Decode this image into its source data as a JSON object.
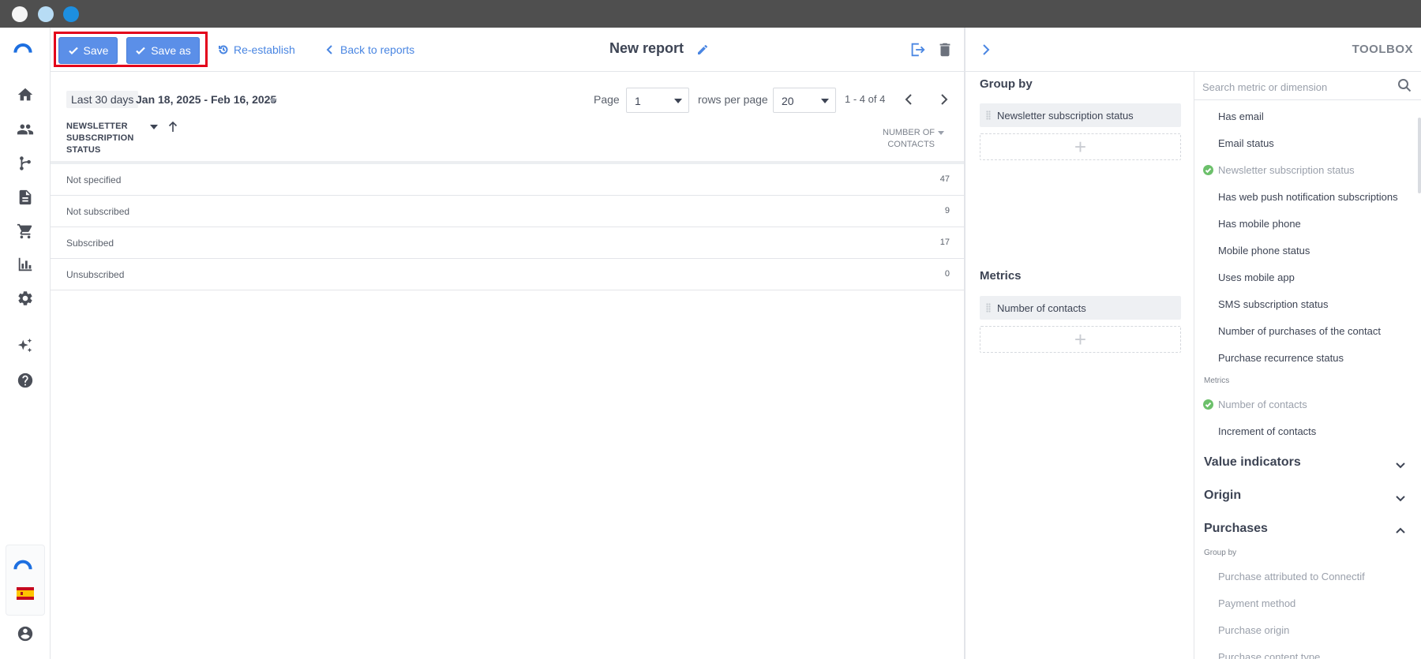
{
  "window": {
    "dot_colors": [
      "#f5f5f5",
      "#b7dcf5",
      "#1d8fe0"
    ]
  },
  "sidebar": {
    "items": [
      {
        "icon": "home-icon"
      },
      {
        "icon": "contacts-icon"
      },
      {
        "icon": "flows-icon"
      },
      {
        "icon": "document-icon"
      },
      {
        "icon": "cart-icon"
      },
      {
        "icon": "bar-chart-icon"
      },
      {
        "icon": "settings-icon"
      },
      {
        "icon": "sparkles-icon"
      },
      {
        "icon": "help-icon"
      }
    ],
    "language_flag": "spain-flag-icon"
  },
  "toolbar": {
    "save_label": "Save",
    "save_as_label": "Save as",
    "reestablish_label": "Re-establish",
    "back_label": "Back to reports",
    "title": "New report",
    "accent_color": "#5b8fe8",
    "highlight_color": "#e3001b"
  },
  "filters": {
    "date_preset": "Last 30 days",
    "date_range": "Jan 18, 2025 - Feb 16, 2025",
    "page_label": "Page",
    "page_value": "1",
    "rows_label": "rows per page",
    "rows_value": "20",
    "range_label": "1 - 4 of 4"
  },
  "table": {
    "col1_header": "Newsletter subscription status",
    "col2_header": "Number of contacts",
    "rows": [
      {
        "status": "Not specified",
        "count": "47"
      },
      {
        "status": "Not subscribed",
        "count": "9"
      },
      {
        "status": "Subscribed",
        "count": "17"
      },
      {
        "status": "Unsubscribed",
        "count": "0"
      }
    ]
  },
  "config": {
    "group_by_title": "Group by",
    "group_by_items": [
      "Newsletter subscription status"
    ],
    "metrics_title": "Metrics",
    "metrics_items": [
      "Number of contacts"
    ],
    "dropzone_symbol": "+"
  },
  "toolbox": {
    "title": "TOOLBOX",
    "search_placeholder": "Search metric or dimension",
    "dimension_items": [
      {
        "label": "Has email",
        "used": false
      },
      {
        "label": "Email status",
        "used": false
      },
      {
        "label": "Newsletter subscription status",
        "used": true
      },
      {
        "label": "Has web push notification subscriptions",
        "used": false
      },
      {
        "label": "Has mobile phone",
        "used": false
      },
      {
        "label": "Mobile phone status",
        "used": false
      },
      {
        "label": "Uses mobile app",
        "used": false
      },
      {
        "label": "SMS subscription status",
        "used": false
      },
      {
        "label": "Number of purchases of the contact",
        "used": false
      },
      {
        "label": "Purchase recurrence status",
        "used": false
      }
    ],
    "metrics_caption": "Metrics",
    "metric_items": [
      {
        "label": "Number of contacts",
        "used": true
      },
      {
        "label": "Increment of contacts",
        "used": false
      }
    ],
    "sections": [
      {
        "label": "Value indicators",
        "expanded": false
      },
      {
        "label": "Origin",
        "expanded": false
      },
      {
        "label": "Purchases",
        "expanded": true
      }
    ],
    "purchases_caption": "Group by",
    "purchase_items": [
      "Purchase attributed to Connectif",
      "Payment method",
      "Purchase origin",
      "Purchase content type"
    ]
  }
}
